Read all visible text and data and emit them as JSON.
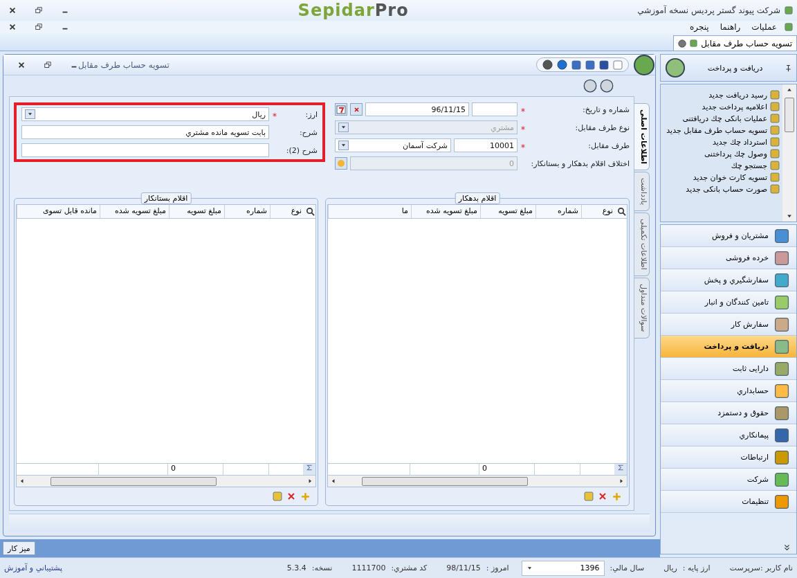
{
  "app": {
    "title": "شرکت پیوند گستر پردیس نسخه آموزشي",
    "logo_a": "Sepidar",
    "logo_b": "Pro"
  },
  "menu": [
    "عملیات",
    "راهنما",
    "پنجره"
  ],
  "doc_tabs": [
    {
      "label": "تسویه حساب طرف مقابل",
      "selected": true
    }
  ],
  "window": {
    "title": "تسویه حساب طرف مقابل"
  },
  "form": {
    "highlighted": true,
    "right": [
      {
        "kind": "numdate",
        "label": "شماره و تاريخ:",
        "required": true,
        "date": "96/11/15"
      },
      {
        "kind": "combo",
        "label": "نوع طرف مقابل:",
        "required": true,
        "value": "مشتري",
        "disabled": true
      },
      {
        "kind": "party",
        "label": "طرف مقابل:",
        "required": true,
        "code": "10001",
        "value": "شرکت آسمان"
      },
      {
        "kind": "readout",
        "label": "اختلاف اقلام بدهکار و بستانکار:",
        "required": false,
        "value": "0"
      }
    ],
    "left": [
      {
        "kind": "combo",
        "label": "ارز:",
        "required": true,
        "value": "ریال",
        "disabled": false
      },
      {
        "kind": "text",
        "label": "شرح:",
        "required": false,
        "value": "بابت تسویه مانده مشتري"
      },
      {
        "kind": "text",
        "label": "شرح (2):",
        "required": false
      }
    ]
  },
  "side_tabs": [
    {
      "label": "اطلاعات اصلی",
      "selected": true
    },
    {
      "label": "یادداشت",
      "selected": false
    },
    {
      "label": "اطلاعات تکمیلی",
      "selected": false
    },
    {
      "label": "سوالات متداول",
      "selected": false
    }
  ],
  "grids": [
    {
      "title": "اقلام بدهکار",
      "columns": [
        "نوع",
        "شماره",
        "مبلغ تسویه",
        "مبلغ تسویه شده",
        "ما"
      ],
      "sum": "0"
    },
    {
      "title": "اقلام بستانکار",
      "columns": [
        "نوع",
        "شماره",
        "مبلغ تسویه",
        "مبلغ تسویه شده",
        "مانده قابل تسوی"
      ],
      "sum": "0"
    }
  ],
  "sidebar": {
    "header": "دریافت و پرداخت",
    "items": [
      "رسید دریافت جدید",
      "اعلامیه پرداخت جدید",
      "عملیات بانکی چك دریافتنی",
      "تسویه حساب طرف مقابل جدید",
      "استرداد چك جدید",
      "وصول چك پرداختنی",
      "جستجو چك",
      "تسویه کارت خوان جدید",
      "صورت حساب بانکی جدید"
    ],
    "modules": [
      {
        "label": "مشتریان و فروش",
        "selected": false
      },
      {
        "label": "خرده فروشی",
        "selected": false
      },
      {
        "label": "سفارشگیري و پخش",
        "selected": false
      },
      {
        "label": "تامین کنندگان و انبار",
        "selected": false
      },
      {
        "label": "سفارش کار",
        "selected": false
      },
      {
        "label": "دریافت و پرداخت",
        "selected": true
      },
      {
        "label": "دارایی ثابت",
        "selected": false
      },
      {
        "label": "حسابداري",
        "selected": false
      },
      {
        "label": "حقوق و دستمزد",
        "selected": false
      },
      {
        "label": "پیمانکاري",
        "selected": false
      },
      {
        "label": "ارتباطات",
        "selected": false
      },
      {
        "label": "شرکت",
        "selected": false
      },
      {
        "label": "تنظیمات",
        "selected": false
      }
    ]
  },
  "taskbar": {
    "button": "میز کار"
  },
  "status": {
    "user": "نام کاربر :سرپرست",
    "base_label": "ارز پایه :",
    "base": "ریال",
    "year_label": "سال مالي:",
    "year": "1396",
    "today_label": "امروز :",
    "today": "98/11/15",
    "cust_label": "کد مشتري:",
    "cust": "1111700",
    "ver_label": "نسخه:",
    "ver": "5.3.4",
    "support": "پشتيباني و آموزش"
  }
}
